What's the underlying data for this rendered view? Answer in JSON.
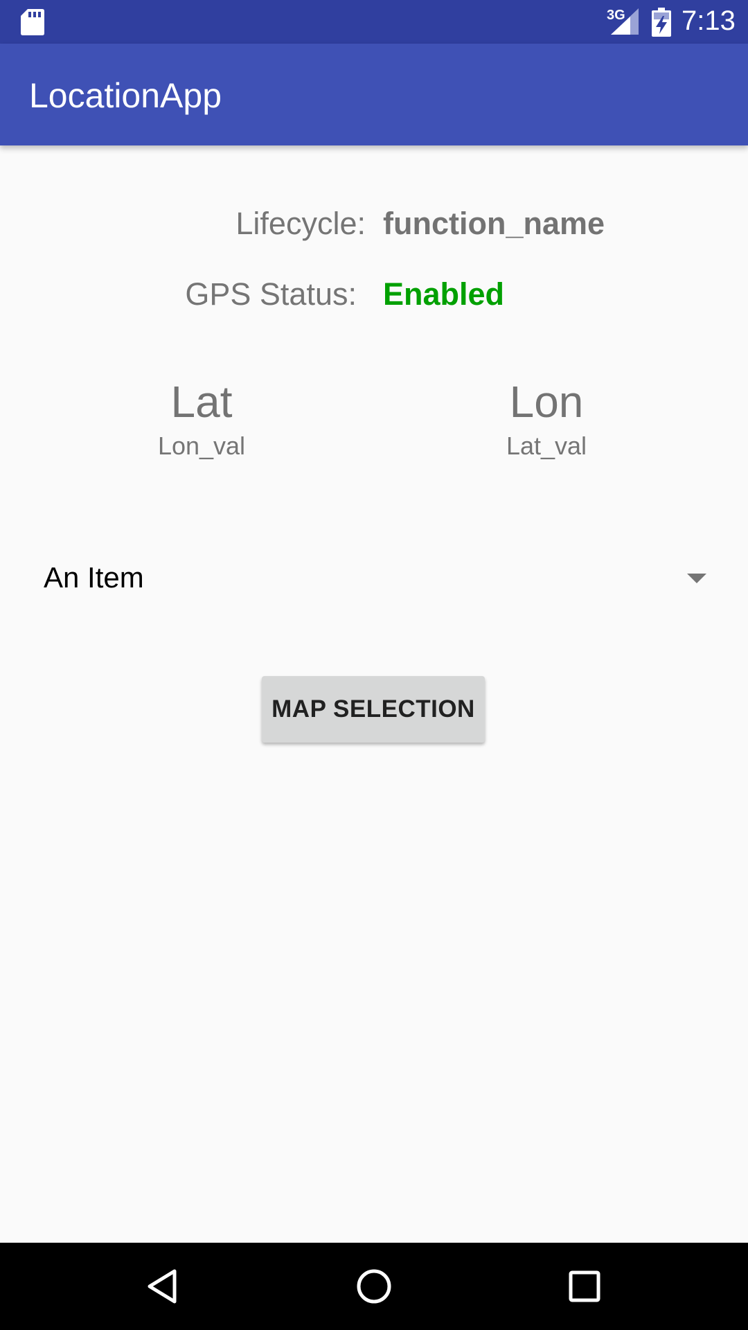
{
  "status_bar": {
    "network_type": "3G",
    "time": "7:13",
    "icons": [
      "sd-card-icon",
      "signal-icon",
      "battery-charging-icon"
    ]
  },
  "app_bar": {
    "title": "LocationApp"
  },
  "info": {
    "lifecycle_label": "Lifecycle:",
    "lifecycle_value": "function_name",
    "gps_label": "GPS Status:",
    "gps_value": "Enabled"
  },
  "coordinates": {
    "lat_title": "Lat",
    "lat_value": "Lon_val",
    "lon_title": "Lon",
    "lon_value": "Lat_val"
  },
  "spinner": {
    "selected": "An Item"
  },
  "map_button": {
    "label": "MAP SELECTION"
  },
  "colors": {
    "status_bar": "#303f9f",
    "app_bar": "#3f51b5",
    "gps_enabled": "#00a000",
    "background": "#fafafa"
  },
  "nav_bar": {
    "icons": [
      "back-icon",
      "home-icon",
      "recents-icon"
    ]
  }
}
